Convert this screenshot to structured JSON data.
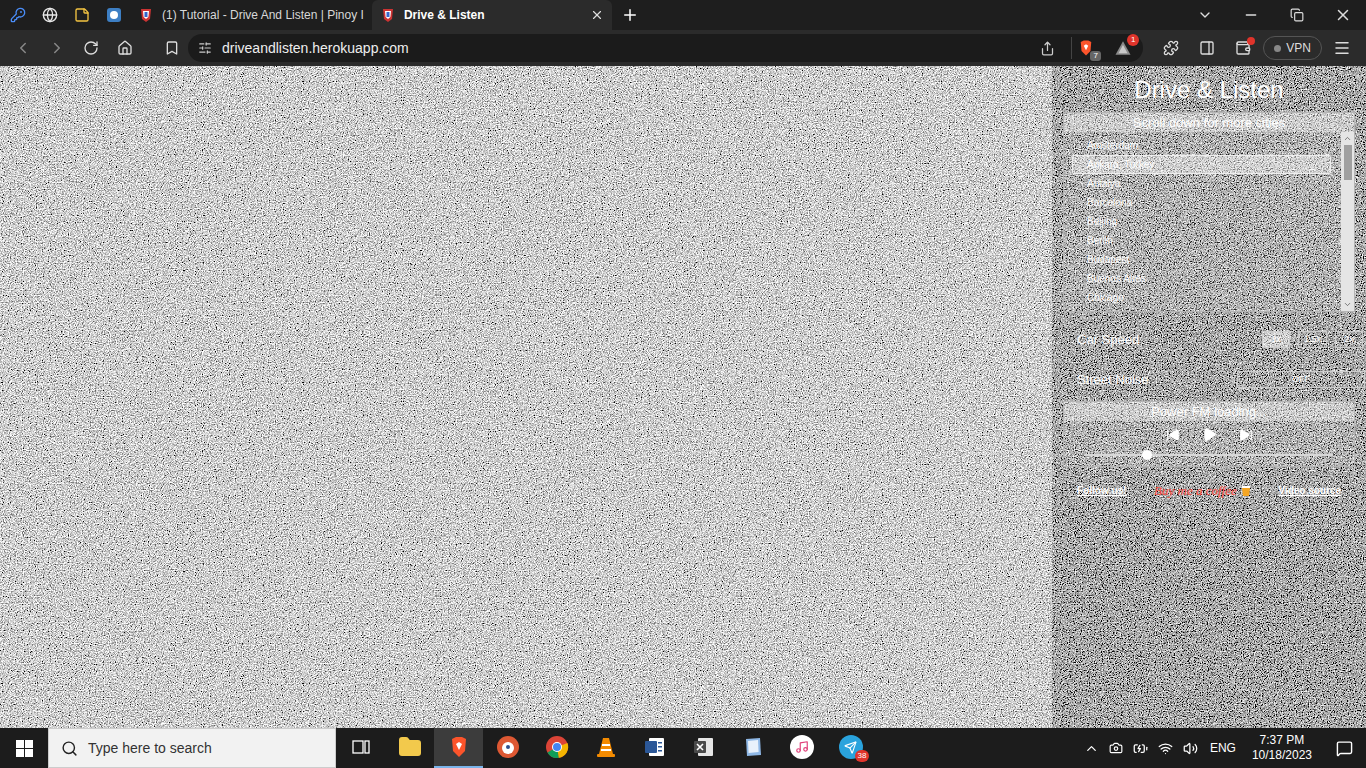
{
  "browser": {
    "pinned_tabs": [
      {
        "kind": "key"
      },
      {
        "kind": "globe"
      },
      {
        "kind": "notes"
      },
      {
        "kind": "app"
      }
    ],
    "tabs": [
      {
        "label": "(1) Tutorial - Drive And Listen | Pinoy I",
        "selected": false
      },
      {
        "label": "Drive & Listen",
        "selected": true
      }
    ],
    "address": "driveandlisten.herokuapp.com",
    "shields_count": "7",
    "alerts_count": "1",
    "vpn": "VPN"
  },
  "page": {
    "title": "Drive & Listen",
    "city_list": {
      "header": "Scroll down for more cities",
      "items": [
        {
          "label": "Amsterdam",
          "selected": false
        },
        {
          "label": "Ankara, Turkey",
          "selected": true
        },
        {
          "label": "Antalya",
          "selected": false
        },
        {
          "label": "Barcelona",
          "selected": false
        },
        {
          "label": "Beijing",
          "selected": false
        },
        {
          "label": "Berlin",
          "selected": false
        },
        {
          "label": "Budapest",
          "selected": false
        },
        {
          "label": "Buenos Aires",
          "selected": false
        },
        {
          "label": "Chicago",
          "selected": false
        }
      ]
    },
    "car_speed": {
      "label": "Car Speed",
      "options": [
        {
          "label": "1x",
          "selected": true
        },
        {
          "label": "1.5x",
          "selected": false
        },
        {
          "label": "2x",
          "selected": false
        }
      ]
    },
    "street_noise": {
      "label": "Street Noise",
      "value": "OFF"
    },
    "radio": {
      "status": "Power FM loading...",
      "level": 0.25
    },
    "links": {
      "follow": "Follow us!",
      "coffee": "Buy me a coffee",
      "source": "Video source"
    }
  },
  "taskbar": {
    "search_placeholder": "Type here to search",
    "apps": [
      {
        "kind": "taskview",
        "selected": false
      },
      {
        "kind": "explorer",
        "selected": false
      },
      {
        "kind": "brave",
        "selected": true
      },
      {
        "kind": "duckduckgo",
        "selected": false
      },
      {
        "kind": "chrome",
        "selected": false
      },
      {
        "kind": "vlc",
        "selected": false
      },
      {
        "kind": "word",
        "selected": false
      },
      {
        "kind": "excel",
        "selected": false
      },
      {
        "kind": "notepad",
        "selected": false
      },
      {
        "kind": "itunes",
        "selected": false
      },
      {
        "kind": "telegram",
        "selected": false,
        "badge": "38"
      }
    ],
    "language": "ENG",
    "time": "7:37 PM",
    "date": "10/18/2023"
  }
}
